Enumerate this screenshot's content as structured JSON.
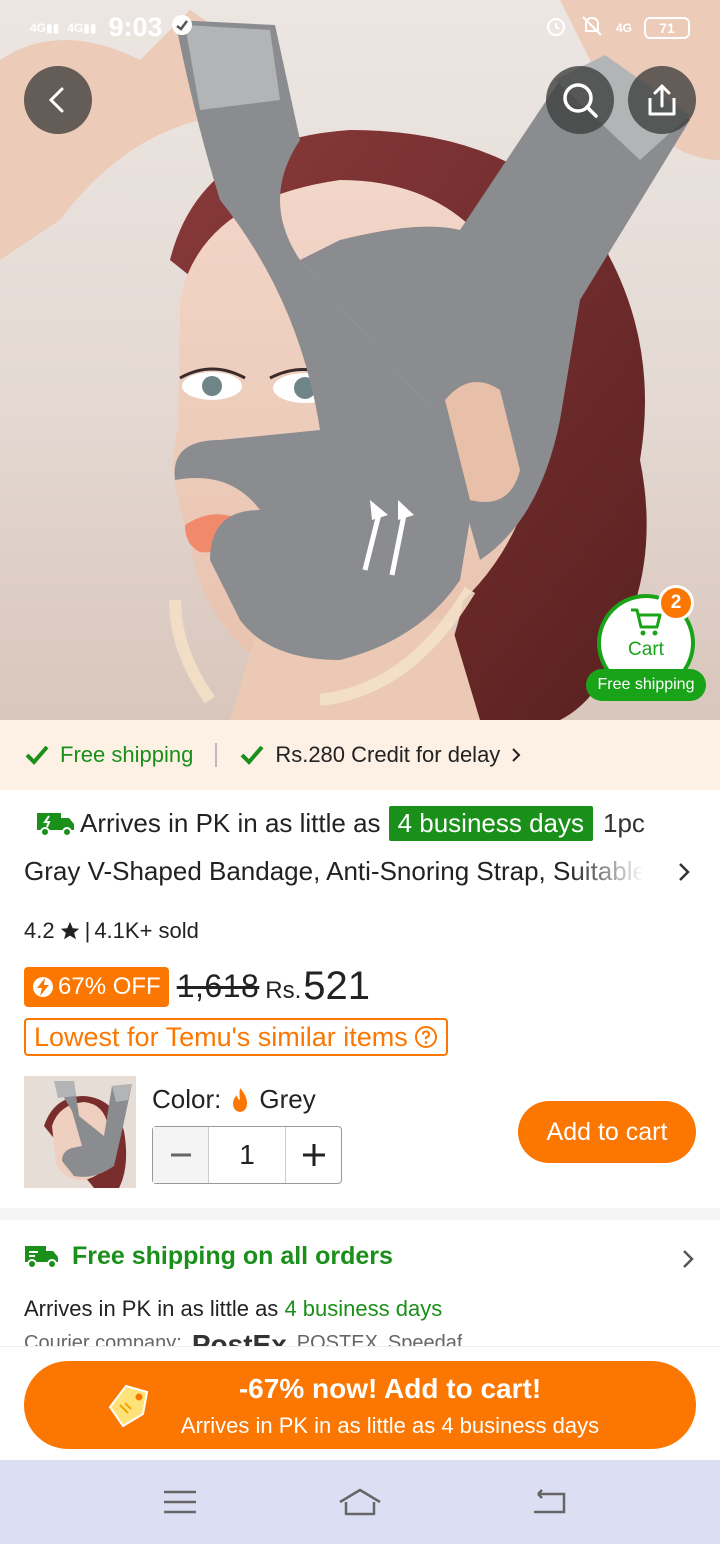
{
  "status_bar": {
    "net1": "4G",
    "net2": "4G",
    "time": "9:03",
    "net3": "4G",
    "battery": "71"
  },
  "hero": {
    "cart_label": "Cart",
    "cart_count": "2",
    "free_shipping_pill": "Free shipping"
  },
  "perks": {
    "free_shipping": "Free shipping",
    "credit": "Rs.280 Credit for delay"
  },
  "product": {
    "arrives_prefix": "Arrives in PK in as little as",
    "arrives_highlight": "4 business days",
    "quantity_pack": "1pc",
    "title": "Gray V-Shaped Bandage, Anti-Snoring Strap, Suitable",
    "rating": "4.2",
    "sold": "4.1K+ sold",
    "discount": "67% OFF",
    "old_price": "1,618",
    "currency": "Rs.",
    "price": "521",
    "lowest_label": "Lowest for Temu's similar items",
    "color_label": "Color:",
    "color_value": "Grey",
    "quantity": "1",
    "add_to_cart": "Add to cart"
  },
  "shipping": {
    "title": "Free shipping on all orders",
    "arrives_prefix": "Arrives in PK in as little as",
    "arrives_days": "4 business days",
    "courier_label": "Courier company:",
    "courier_1": "PostEx",
    "courier_1b": "POSTEX",
    "courier_2": "Speedaf"
  },
  "cta": {
    "line1": "-67% now! Add to cart!",
    "line2": "Arrives in PK in as little as 4 business days"
  },
  "colors": {
    "accent": "#fb7701",
    "green": "#1a8f1a",
    "nav_bg": "#dcdff3"
  }
}
